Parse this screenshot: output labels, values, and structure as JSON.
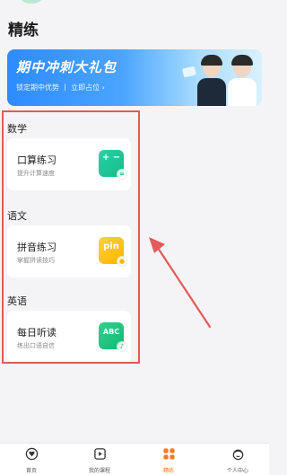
{
  "header": {
    "title": "精练"
  },
  "banner": {
    "title": "期中冲刺大礼包",
    "subtitle": "锁定期中优势 丨 立即占位 ›"
  },
  "sections": [
    {
      "label": "数学",
      "card": {
        "title": "口算练习",
        "subtitle": "提升计算速度",
        "icon_text": "+ −",
        "badge": "=",
        "icon_color": "#1fc597"
      }
    },
    {
      "label": "语文",
      "card": {
        "title": "拼音练习",
        "subtitle": "掌握拼读技巧",
        "icon_text": "pin",
        "badge": "●",
        "icon_color": "#ffc21a"
      }
    },
    {
      "label": "英语",
      "card": {
        "title": "每日听读",
        "subtitle": "练出口语自信",
        "icon_text": "ABC",
        "badge": "♪",
        "icon_color": "#22c482"
      }
    }
  ],
  "tabbar": {
    "items": [
      {
        "label": "首页"
      },
      {
        "label": "我的课程"
      },
      {
        "label": "精练"
      },
      {
        "label": "个人中心"
      }
    ],
    "active_color": "#ff7a1a"
  },
  "annotation": {
    "color": "#e25a5a"
  }
}
